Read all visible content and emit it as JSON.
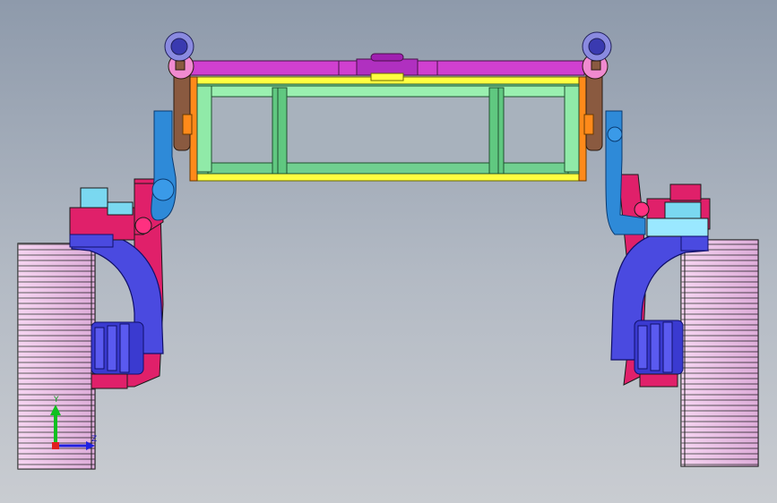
{
  "viewport": {
    "background_top": "#8e9aab",
    "background_bottom": "#c9ccd1"
  },
  "model": {
    "wheel_color": "#f2c6ec",
    "wheel_stroke": "#202020",
    "body_frame_green": "#7fe0a0",
    "frame_yellow": "#ffff40",
    "frame_orange": "#ff8a1a",
    "top_bar_magenta": "#d040d0",
    "knuckle_crimson": "#e0206a",
    "arm_blue": "#4a4ae0",
    "strut_lightblue": "#2e8ad8",
    "bracket_cyan": "#7ad8f0",
    "pivot_brown": "#8a5a40"
  },
  "triad": {
    "y_label": "Y",
    "z_label": "Z",
    "y_color": "#10c020",
    "z_color": "#2020e0",
    "x_color": "#e02020"
  }
}
